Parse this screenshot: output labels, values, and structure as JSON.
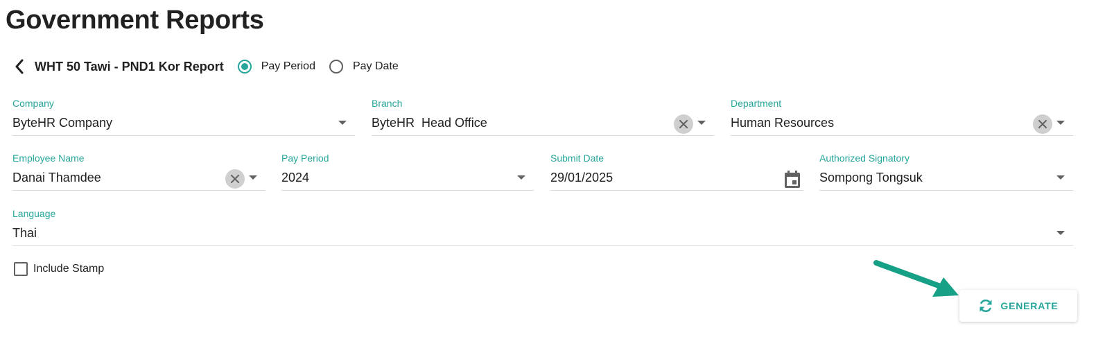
{
  "page": {
    "title": "Government Reports"
  },
  "report": {
    "name": "WHT 50 Tawi - PND1 Kor Report",
    "period_options": [
      {
        "label": "Pay Period",
        "checked": true
      },
      {
        "label": "Pay Date",
        "checked": false
      }
    ]
  },
  "form": {
    "company": {
      "label": "Company",
      "value": "ByteHR Company"
    },
    "branch": {
      "label": "Branch",
      "value": "ByteHR  Head Office"
    },
    "department": {
      "label": "Department",
      "value": "Human Resources"
    },
    "employee_name": {
      "label": "Employee Name",
      "value": "Danai Thamdee"
    },
    "pay_period": {
      "label": "Pay Period",
      "value": "2024"
    },
    "submit_date": {
      "label": "Submit Date",
      "value": "29/01/2025"
    },
    "authorized_signatory": {
      "label": "Authorized Signatory",
      "value": "Sompong Tongsuk"
    },
    "language": {
      "label": "Language",
      "value": "Thai"
    },
    "include_stamp": {
      "label": "Include Stamp",
      "checked": false
    }
  },
  "actions": {
    "generate_label": "GENERATE"
  },
  "colors": {
    "accent": "#26a69a",
    "annotation_arrow": "#16a085"
  }
}
